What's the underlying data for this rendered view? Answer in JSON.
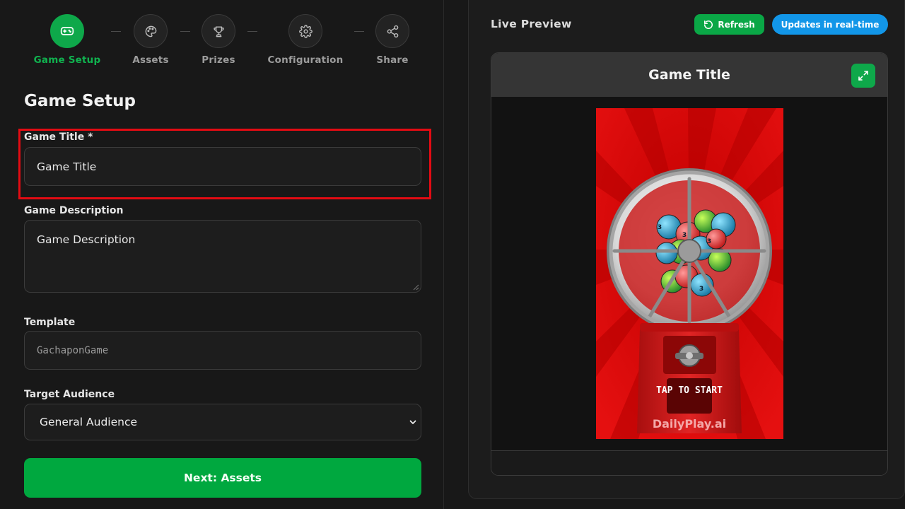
{
  "stepper": {
    "steps": [
      {
        "label": "Game Setup",
        "icon": "gamepad-icon",
        "active": true
      },
      {
        "label": "Assets",
        "icon": "palette-icon",
        "active": false
      },
      {
        "label": "Prizes",
        "icon": "trophy-icon",
        "active": false
      },
      {
        "label": "Configuration",
        "icon": "gear-icon",
        "active": false
      },
      {
        "label": "Share",
        "icon": "share-icon",
        "active": false
      }
    ]
  },
  "form": {
    "section_title": "Game Setup",
    "title_label": "Game Title *",
    "title_value": "Game Title",
    "description_label": "Game Description",
    "description_value": "Game Description",
    "template_label": "Template",
    "template_value": "GachaponGame",
    "audience_label": "Target Audience",
    "audience_value": "General Audience",
    "next_button": "Next: Assets"
  },
  "preview": {
    "heading": "Live Preview",
    "refresh_label": "Refresh",
    "realtime_badge": "Updates in real-time",
    "game_title": "Game Title",
    "tap_text": "TAP TO START",
    "brand_text": "DailyPlay.ai",
    "ball_label": "3"
  },
  "colors": {
    "accent_green": "#0ea84a",
    "badge_blue": "#1296e8",
    "highlight_red": "#e30b13",
    "game_bg_red": "#d80a0a"
  }
}
